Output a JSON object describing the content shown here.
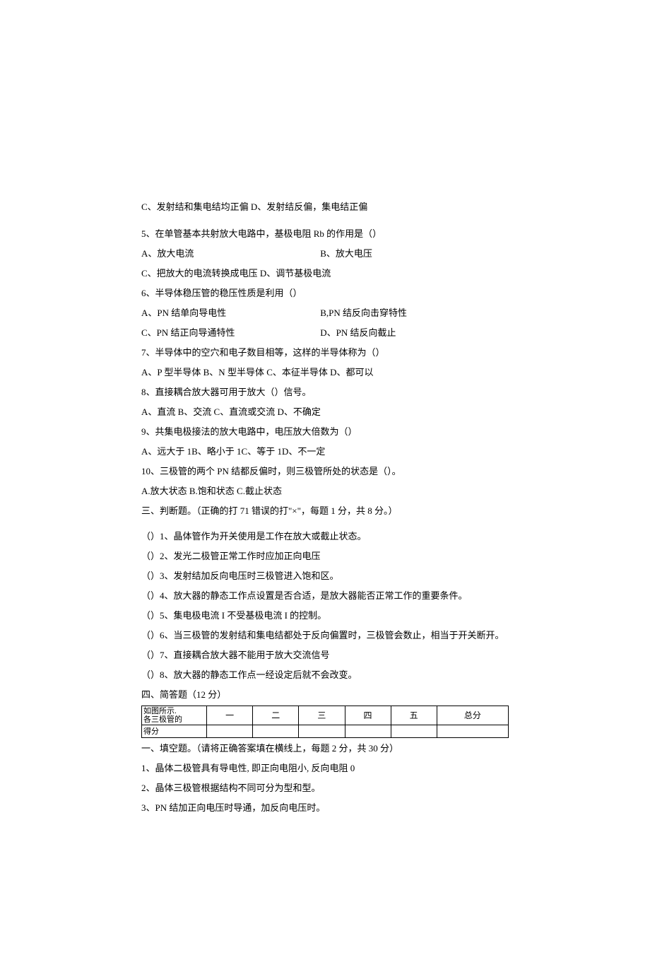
{
  "lines": {
    "l1": "C、发射结和集电结均正偏 D、发射结反偏，集电结正偏",
    "l2": "5、在单管基本共射放大电路中，基极电阻 Rb 的作用是（）",
    "l3a": "A、放大电流",
    "l3b": "B、放大电压",
    "l4": "C、把放大的电流转换成电压 D、调节基极电流",
    "l5": "6、半导体稳压管的稳压性质是利用（）",
    "l6a": "A、PN 结单向导电性",
    "l6b": "B,PN 结反向击穿特性",
    "l7a": "C、PN 结正向导通特性",
    "l7b": "D、PN 结反向截止",
    "l8": "7、半导体中的空穴和电子数目相等，这样的半导体称为（）",
    "l9": "A、P 型半导体 B、N 型半导体 C、本征半导体 D、都可以",
    "l10": "8、直接耦合放大器可用于放大（）信号。",
    "l11": "A、直流 B、交流 C、直流或交流 D、不确定",
    "l12": "9、共集电极接法的放大电路中，电压放大倍数为（）",
    "l13": "A、远大于 1B、略小于 1C、等于 1D、不一定",
    "l14": "10、三极管的两个 PN 结都反偏时，则三极管所处的状态是（）。",
    "l15": "A.放大状态          B.饱和状态     C.截止状态",
    "l16": "三、判断题。（正确的打 71 错误的打\"×\"，每题 1 分，共 8 分。）",
    "l17": "（）1、晶体管作为开关使用是工作在放大或截止状态。",
    "l18": "（）2、发光二极管正常工作时应加正向电压",
    "l19": "（）3、发射结加反向电压时三极管进入饱和区。",
    "l20": "（）4、放大器的静态工作点设置是否合适，是放大器能否正常工作的重要条件。",
    "l21": "（）5、集电极电流 I 不受基极电流 I 的控制。",
    "l22": "（）6、当三极管的发射结和集电结都处于反向偏置时，三极管会数止，相当于开关断开。",
    "l23": "（）7、直接耦合放大器不能用于放大交流信号",
    "l24": "（）8、放大器的静态工作点一经设定后就不会改变。",
    "l25": "四、简答题（12 分）",
    "tbl_r1c0a": "如图所示.",
    "tbl_r1c0b": "各三极管的",
    "tbl_r1c1": "一",
    "tbl_r1c2": "二",
    "tbl_r1c3": "三",
    "tbl_r1c4": "四",
    "tbl_r1c5": "五",
    "tbl_r1c6": "总分",
    "tbl_r2c0": "得分",
    "l26": "一、填空题。（请将正确答案填在横线上，每题 2 分，共 30 分）",
    "l27": "1、晶体二极管具有导电性, 即正向电阻小, 反向电阻 0",
    "l28": "2、晶体三极管根据结构不同可分为型和型。",
    "l29": "3、PN 结加正向电压时导通，加反向电压时。"
  }
}
